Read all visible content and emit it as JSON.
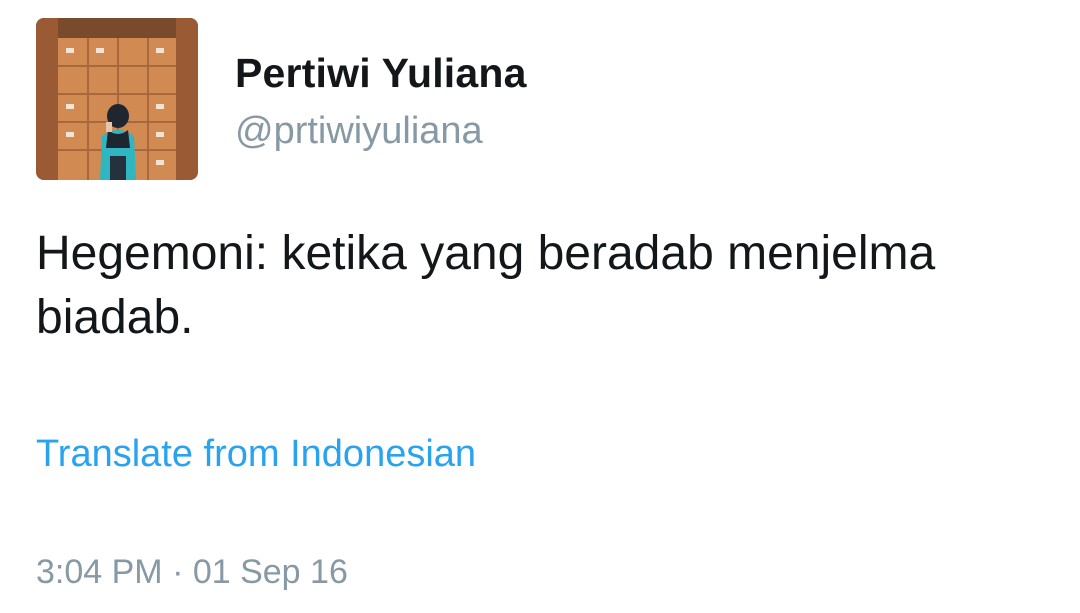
{
  "user": {
    "display_name": "Pertiwi Yuliana",
    "handle": "@prtiwiyuliana"
  },
  "tweet": {
    "text": "Hegemoni: ketika yang beradab menjelma biadab.",
    "translate_label": "Translate from Indonesian",
    "timestamp": "3:04 PM · 01 Sep 16"
  },
  "colors": {
    "text": "#14171a",
    "secondary": "#8899a6",
    "link": "#2aa3ef"
  }
}
